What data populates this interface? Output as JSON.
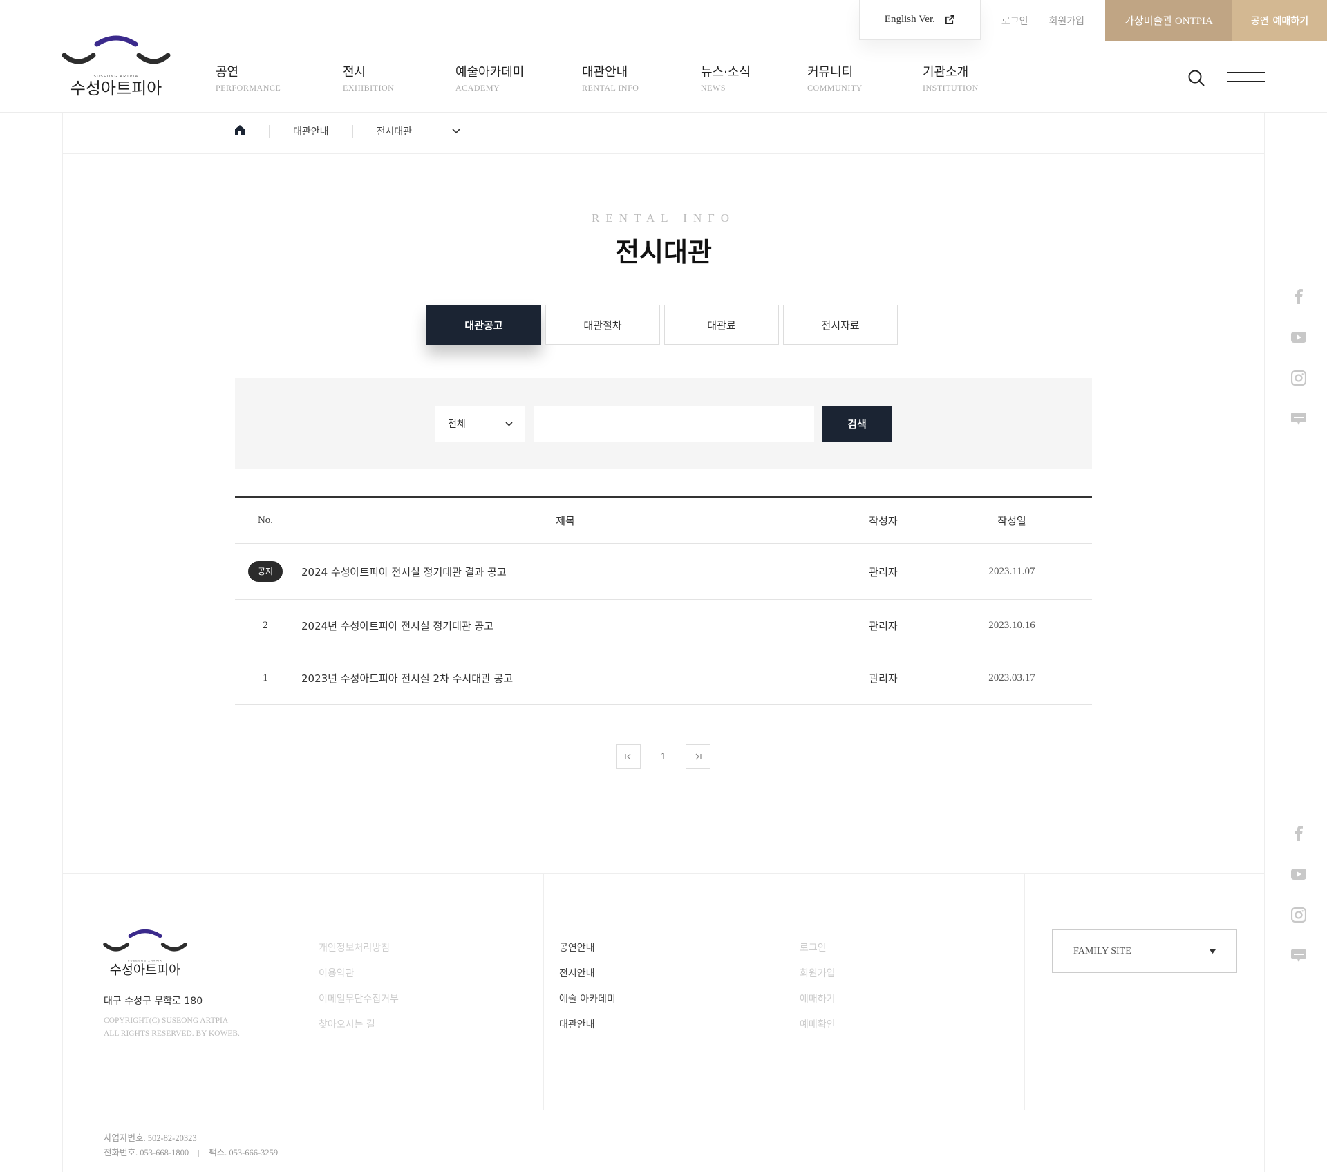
{
  "util": {
    "english": "English Ver.",
    "login": "로그인",
    "join": "회원가입",
    "ontpia": "가상미술관 ONTPIA",
    "book_prefix": "공연",
    "book": "예매하기"
  },
  "logo": {
    "en": "SUSEONG ARTPIA",
    "ko": "수성아트피아"
  },
  "gnb": [
    {
      "ko": "공연",
      "en": "PERFORMANCE"
    },
    {
      "ko": "전시",
      "en": "EXHIBITION"
    },
    {
      "ko": "예술아카데미",
      "en": "ACADEMY"
    },
    {
      "ko": "대관안내",
      "en": "RENTAL INFO"
    },
    {
      "ko": "뉴스·소식",
      "en": "NEWS"
    },
    {
      "ko": "커뮤니티",
      "en": "COMMUNITY"
    },
    {
      "ko": "기관소개",
      "en": "INSTITUTION"
    }
  ],
  "breadcrumb": {
    "level1": "대관안내",
    "level2": "전시대관"
  },
  "page": {
    "subtitle_en": "RENTAL INFO",
    "title": "전시대관"
  },
  "tabs": [
    "대관공고",
    "대관절차",
    "대관료",
    "전시자료"
  ],
  "search": {
    "select_value": "전체",
    "input_value": "",
    "button": "검색"
  },
  "table": {
    "headers": {
      "no": "No.",
      "title": "제목",
      "writer": "작성자",
      "date": "작성일"
    },
    "rows": [
      {
        "no": "공지",
        "title": "2024 수성아트피아 전시실 정기대관 결과 공고",
        "writer": "관리자",
        "date": "2023.11.07"
      },
      {
        "no": "2",
        "title": "2024년 수성아트피아 전시실 정기대관 공고",
        "writer": "관리자",
        "date": "2023.10.16"
      },
      {
        "no": "1",
        "title": "2023년 수성아트피아 전시실 2차 수시대관 공고",
        "writer": "관리자",
        "date": "2023.03.17"
      }
    ]
  },
  "pager": {
    "current": "1"
  },
  "footer": {
    "address": "대구 수성구 무학로 180",
    "copyright1": "COPYRIGHT(C) SUSEONG ARTPIA",
    "copyright2": "ALL RIGHTS RESERVED. BY KOWEB.",
    "col1": [
      "개인정보처리방침",
      "이용약관",
      "이메일무단수집거부",
      "찾아오시는 길"
    ],
    "col2": [
      "공연안내",
      "전시안내",
      "예술 아카데미",
      "대관안내"
    ],
    "col3": [
      "로그인",
      "회원가입",
      "예매하기",
      "예매확인"
    ],
    "family_site": "FAMILY SITE",
    "biz_no": "사업자번호. 502-82-20323",
    "tel": "전화번호. 053-668-1800",
    "fax": "팩스. 053-666-3259"
  },
  "colors": {
    "navy": "#1b2433",
    "gold": "#c0a584",
    "gold_light": "#d3b892",
    "logo_purple": "#3b2a8c"
  }
}
